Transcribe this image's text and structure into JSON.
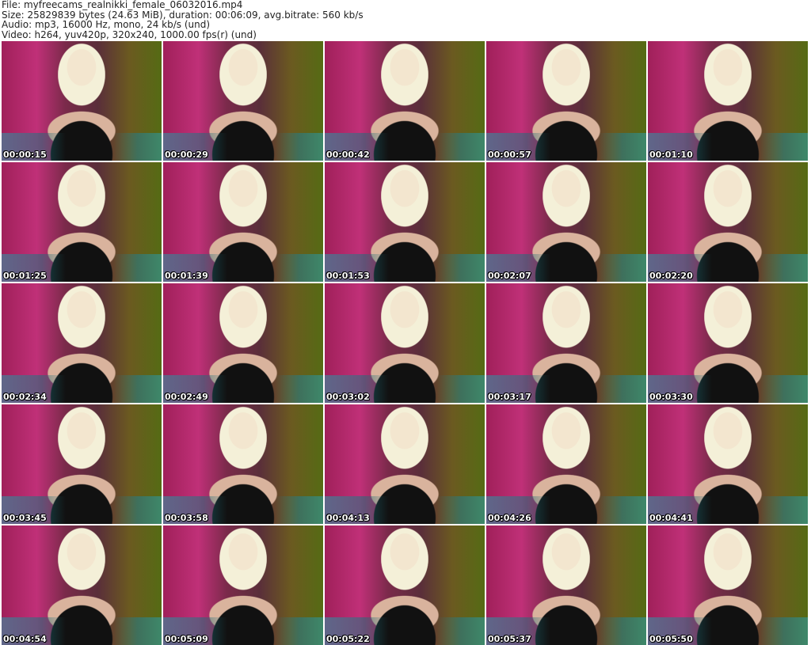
{
  "header": {
    "file": "File: myfreecams_realnikki_female_06032016.mp4",
    "size": "Size: 25829839 bytes (24.63 MiB), duration: 00:06:09, avg.bitrate: 560 kb/s",
    "audio": "Audio: mp3, 16000 Hz, mono, 24 kb/s (und)",
    "video": "Video: h264, yuv420p, 320x240, 1000.00 fps(r) (und)"
  },
  "timestamps": [
    "00:00:15",
    "00:00:29",
    "00:00:42",
    "00:00:57",
    "00:01:10",
    "00:01:25",
    "00:01:39",
    "00:01:53",
    "00:02:07",
    "00:02:20",
    "00:02:34",
    "00:02:49",
    "00:03:02",
    "00:03:17",
    "00:03:30",
    "00:03:45",
    "00:03:58",
    "00:04:13",
    "00:04:26",
    "00:04:41",
    "00:04:54",
    "00:05:09",
    "00:05:22",
    "00:05:37",
    "00:05:50"
  ]
}
